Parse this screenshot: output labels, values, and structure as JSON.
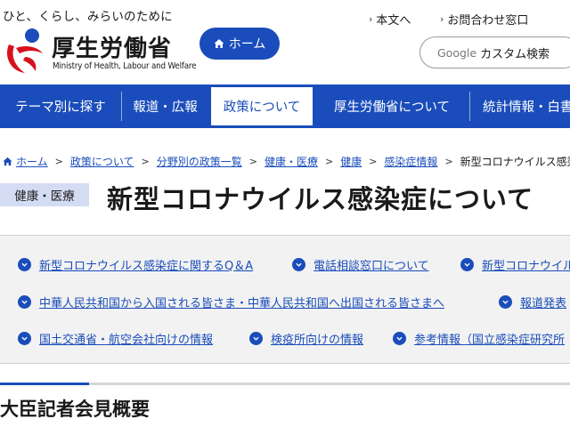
{
  "header": {
    "tagline": "ひと、くらし、みらいのために",
    "logo_name": "厚生労働省",
    "logo_sub": "Ministry of Health, Labour and Welfare",
    "home_label": "ホーム",
    "util_links": [
      {
        "label": "本文へ"
      },
      {
        "label": "お問合わせ窓口"
      }
    ],
    "search": {
      "brand": "Google",
      "label": "カスタム検索"
    }
  },
  "gnav": [
    {
      "label": "テーマ別に探す"
    },
    {
      "label": "報道・広報"
    },
    {
      "label": "政策について",
      "active": true
    },
    {
      "label": "厚生労働省について"
    },
    {
      "label": "統計情報・白書"
    }
  ],
  "breadcrumb": [
    {
      "label": "ホーム"
    },
    {
      "label": "政策について"
    },
    {
      "label": "分野別の政策一覧"
    },
    {
      "label": "健康・医療"
    },
    {
      "label": "健康"
    },
    {
      "label": "感染症情報"
    },
    {
      "label": "新型コロナウイルス感染症について"
    }
  ],
  "category_tag": "健康・医療",
  "page_title": "新型コロナウイルス感染症について",
  "links": [
    [
      "新型コロナウイルス感染症に関するQ＆A",
      "電話相談窓口について",
      "新型コロナウイルス"
    ],
    [
      "中華人民共和国から入国される皆さま・中華人民共和国へ出国される皆さまへ",
      "報道発表"
    ],
    [
      "国土交通省・航空会社向けの情報",
      "検疫所向けの情報",
      "参考情報（国立感染症研究所"
    ]
  ],
  "section_title": "大臣記者会見概要",
  "colors": {
    "brand_blue": "#1a4dbb",
    "logo_red": "#d7111b",
    "tag_bg": "#d4dcf4",
    "panel_bg": "#f2f2f2"
  },
  "icons": {
    "home": "home-icon",
    "link_bullet": "circle-chevron-icon",
    "util": "chevron-right-icon",
    "crumb_home": "home-icon"
  }
}
